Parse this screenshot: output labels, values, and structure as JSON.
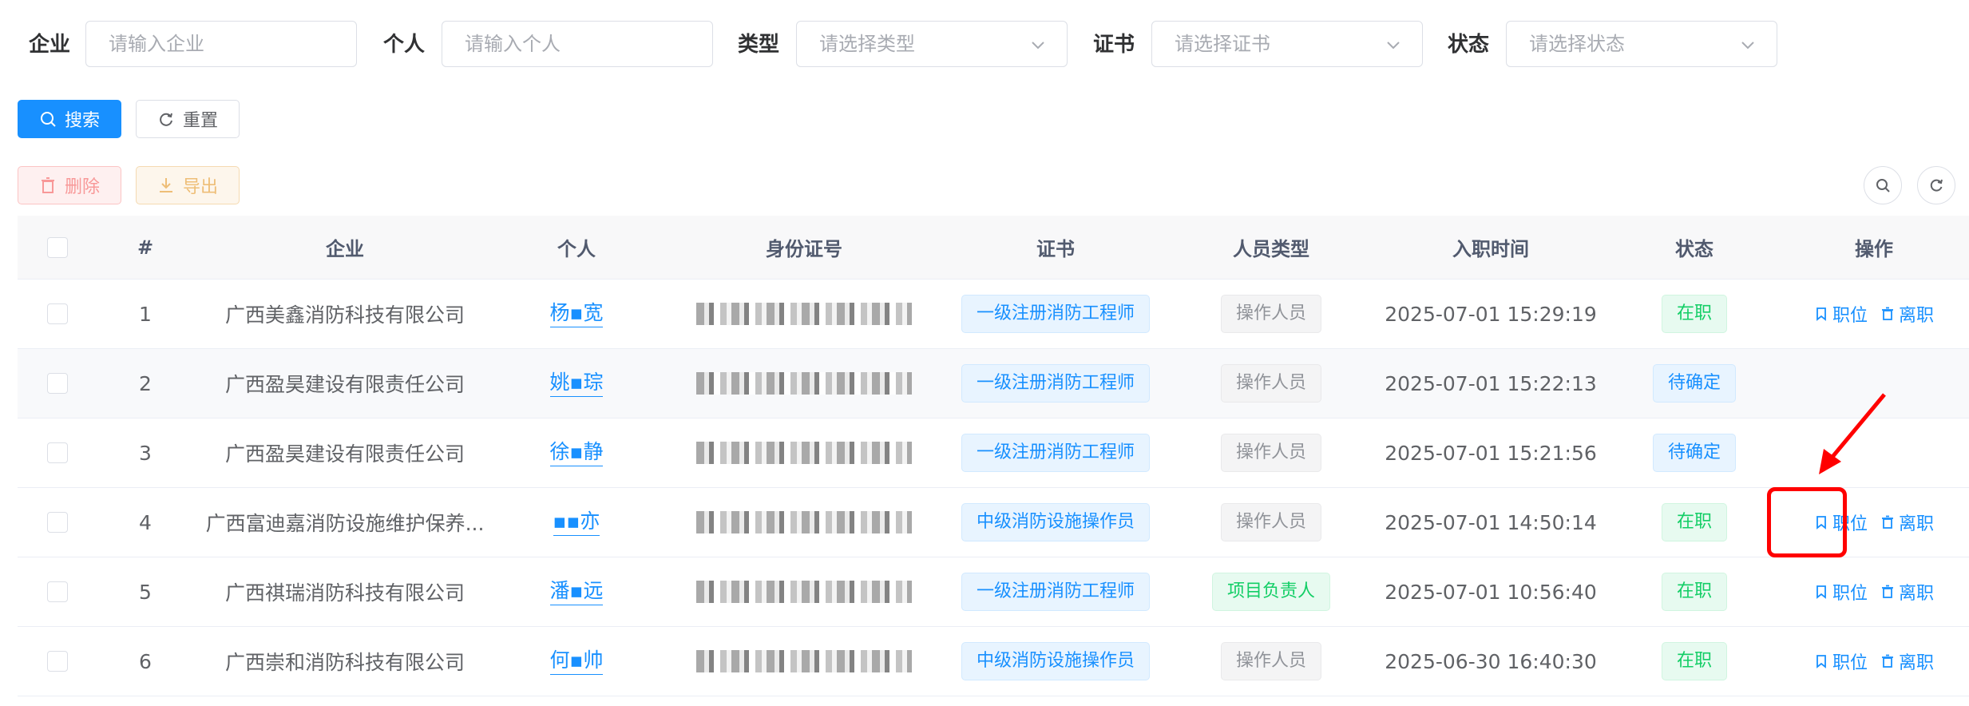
{
  "filters": {
    "enterprise": {
      "label": "企业",
      "placeholder": "请输入企业"
    },
    "person": {
      "label": "个人",
      "placeholder": "请输入个人"
    },
    "type": {
      "label": "类型",
      "placeholder": "请选择类型"
    },
    "certificate": {
      "label": "证书",
      "placeholder": "请选择证书"
    },
    "status": {
      "label": "状态",
      "placeholder": "请选择状态"
    }
  },
  "buttons": {
    "search": "搜索",
    "reset": "重置",
    "delete": "删除",
    "export": "导出"
  },
  "table": {
    "columns": [
      "#",
      "企业",
      "个人",
      "身份证号",
      "证书",
      "人员类型",
      "入职时间",
      "状态",
      "操作"
    ],
    "rows": [
      {
        "index": "1",
        "enterprise": "广西美鑫消防科技有限公司",
        "person": "杨▪宽",
        "certificate": "一级注册消防工程师",
        "staff_type": "操作人员",
        "hire_time": "2025-07-01 15:29:19",
        "status": "在职",
        "status_kind": "green"
      },
      {
        "index": "2",
        "enterprise": "广西盈昊建设有限责任公司",
        "person": "姚▪琮",
        "certificate": "一级注册消防工程师",
        "staff_type": "操作人员",
        "hire_time": "2025-07-01 15:22:13",
        "status": "待确定",
        "status_kind": "blue"
      },
      {
        "index": "3",
        "enterprise": "广西盈昊建设有限责任公司",
        "person": "徐▪静",
        "certificate": "一级注册消防工程师",
        "staff_type": "操作人员",
        "hire_time": "2025-07-01 15:21:56",
        "status": "待确定",
        "status_kind": "blue"
      },
      {
        "index": "4",
        "enterprise": "广西富迪嘉消防设施维护保养...",
        "person": "▪▪亦",
        "certificate": "中级消防设施操作员",
        "staff_type": "操作人员",
        "hire_time": "2025-07-01 14:50:14",
        "status": "在职",
        "status_kind": "green"
      },
      {
        "index": "5",
        "enterprise": "广西祺瑞消防科技有限公司",
        "person": "潘▪远",
        "certificate": "一级注册消防工程师",
        "staff_type": "项目负责人",
        "hire_time": "2025-07-01 10:56:40",
        "status": "在职",
        "status_kind": "green"
      },
      {
        "index": "6",
        "enterprise": "广西崇和消防科技有限公司",
        "person": "何▪帅",
        "certificate": "中级消防设施操作员",
        "staff_type": "操作人员",
        "hire_time": "2025-06-30 16:40:30",
        "status": "在职",
        "status_kind": "green"
      }
    ],
    "op_position": "职位",
    "op_resign": "离职"
  },
  "colors": {
    "primary": "#1890ff",
    "success": "#13ce66",
    "danger": "#f56c6c",
    "annotation": "#ff0000"
  }
}
